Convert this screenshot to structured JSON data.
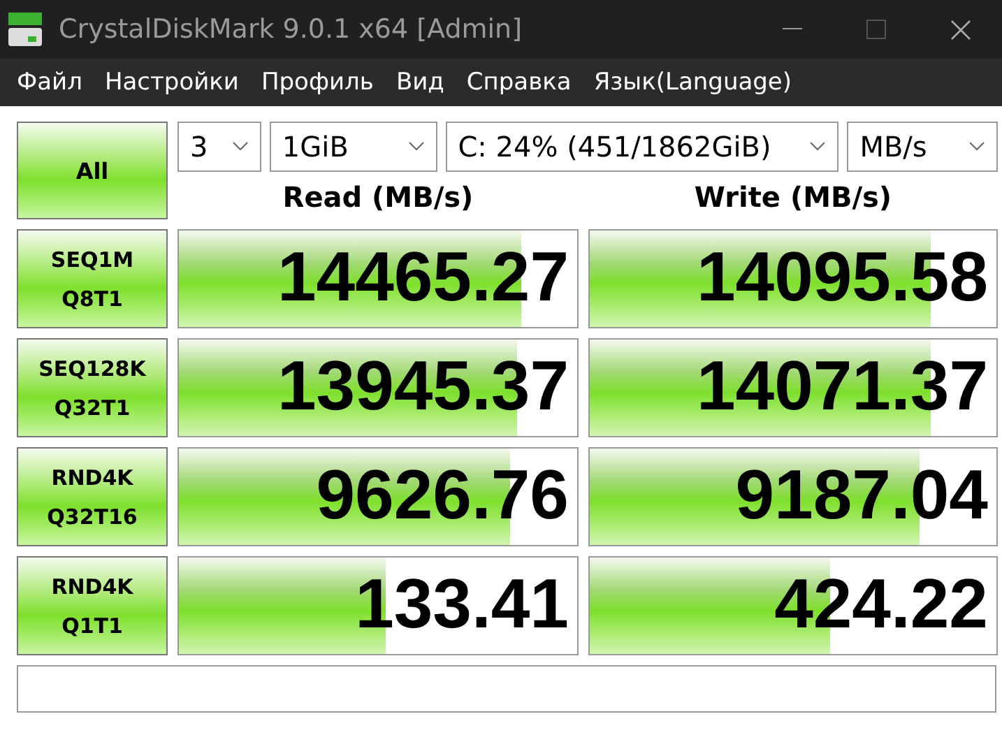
{
  "window": {
    "title": "CrystalDiskMark 9.0.1 x64 [Admin]"
  },
  "menu": [
    "Файл",
    "Настройки",
    "Профиль",
    "Вид",
    "Справка",
    "Язык(Language)"
  ],
  "all_button": "All",
  "selects": [
    {
      "value": "3"
    },
    {
      "value": "1GiB"
    },
    {
      "value": "C: 24% (451/1862GiB)"
    },
    {
      "value": "MB/s"
    }
  ],
  "columns": [
    "Read (MB/s)",
    "Write (MB/s)"
  ],
  "rows": [
    {
      "test": [
        "SEQ1M",
        "Q8T1"
      ],
      "read": {
        "value": "14465.27",
        "level": 0.86
      },
      "write": {
        "value": "14095.58",
        "level": 0.84
      }
    },
    {
      "test": [
        "SEQ128K",
        "Q32T1"
      ],
      "read": {
        "value": "13945.37",
        "level": 0.85
      },
      "write": {
        "value": "14071.37",
        "level": 0.84
      }
    },
    {
      "test": [
        "RND4K",
        "Q32T16"
      ],
      "read": {
        "value": "9626.76",
        "level": 0.83
      },
      "write": {
        "value": "9187.04",
        "level": 0.81
      }
    },
    {
      "test": [
        "RND4K",
        "Q1T1"
      ],
      "read": {
        "value": "133.41",
        "level": 0.52
      },
      "write": {
        "value": "424.22",
        "level": 0.59
      }
    }
  ]
}
